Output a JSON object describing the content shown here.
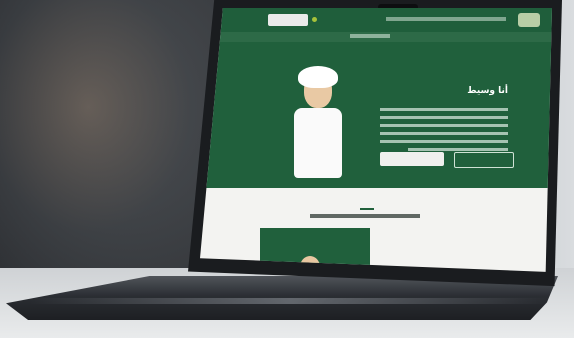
{
  "scene": "laptop-on-desk",
  "website": {
    "header": {
      "button_label": "",
      "logo_icon": "site-logo-icon"
    },
    "hero": {
      "heading": "أنا وسيط",
      "character_icon": "character-illustration-icon"
    },
    "section": {
      "heading": ""
    }
  },
  "colors": {
    "brand_green": "#20603c",
    "light_bg": "#f3f3f1"
  }
}
